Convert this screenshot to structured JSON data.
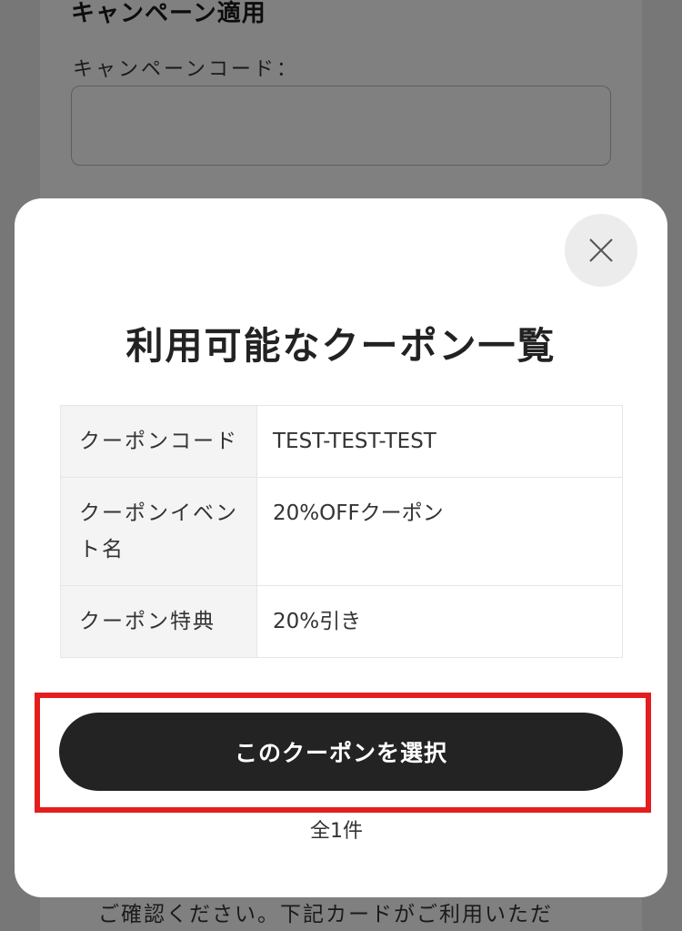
{
  "background": {
    "section_title": "キャンペーン適用",
    "code_label": "キャンペーンコード：",
    "code_value": "",
    "footer_text": "ご確認ください。下記カードがご利用いただ"
  },
  "modal": {
    "title": "利用可能なクーポン一覧",
    "close_icon": "close-icon",
    "rows": [
      {
        "label": "クーポンコード",
        "value": "TEST-TEST-TEST"
      },
      {
        "label": "クーポンイベント名",
        "value": "20%OFFクーポン"
      },
      {
        "label": "クーポン特典",
        "value": "20%引き"
      }
    ],
    "select_button_label": "このクーポンを選択",
    "count_text": "全1件"
  },
  "colors": {
    "overlay": "#777777",
    "button": "#232323",
    "highlight": "#e41e1e"
  }
}
